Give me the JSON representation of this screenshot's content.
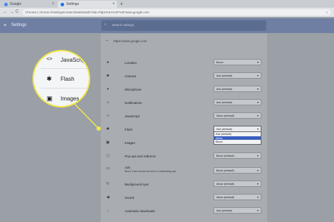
{
  "browser": {
    "tabs": [
      {
        "label": "Google",
        "favicon_color": "#4285f4"
      },
      {
        "label": "Settings",
        "favicon_color": "#1a73e8"
      }
    ],
    "new_tab_glyph": "+",
    "close_glyph": "×",
    "back_glyph": "←",
    "forward_glyph": "→",
    "reload_glyph": "C",
    "address": "Chrome | chrome://settings/content/siteDetails?site=https%3A%2F%2Fwww.google.com",
    "star_glyph": "☆"
  },
  "header": {
    "menu_glyph": "≡",
    "title": "Settings",
    "search_icon": "⌕",
    "search_placeholder": "Search settings"
  },
  "site": {
    "back_glyph": "←",
    "url": "https://www.google.com"
  },
  "permissions": [
    {
      "name": "location",
      "icon": "location-icon",
      "glyph": "●",
      "label": "Location",
      "value": "Block"
    },
    {
      "name": "camera",
      "icon": "camera-icon",
      "glyph": "■",
      "label": "Camera",
      "value": "Ask (default)"
    },
    {
      "name": "microphone",
      "icon": "microphone-icon",
      "glyph": "♦",
      "label": "Microphone",
      "value": "Ask (default)"
    },
    {
      "name": "notifications",
      "icon": "bell-icon",
      "glyph": "♫",
      "label": "Notifications",
      "value": "Ask (default)"
    },
    {
      "name": "javascript",
      "icon": "code-icon",
      "glyph": "‹›",
      "label": "JavaScript",
      "value": "Allow (default)"
    },
    {
      "name": "flash",
      "icon": "puzzle-icon",
      "glyph": "✱",
      "label": "Flash",
      "value": "Ask (default)"
    },
    {
      "name": "images",
      "icon": "image-icon",
      "glyph": "▣",
      "label": "Images",
      "value": ""
    },
    {
      "name": "popups",
      "icon": "popup-icon",
      "glyph": "▢",
      "label": "Pop-ups and redirects",
      "value": "Block (default)"
    },
    {
      "name": "ads",
      "icon": "ads-icon",
      "glyph": "▭",
      "label": "Ads",
      "sub": "Block if site shows intrusive or misleading ads",
      "value": "Block (default)"
    },
    {
      "name": "background-sync",
      "icon": "sync-icon",
      "glyph": "↻",
      "label": "Background sync",
      "value": "Allow (default)"
    },
    {
      "name": "sound",
      "icon": "sound-icon",
      "glyph": "◀",
      "label": "Sound",
      "value": "Allow (default)"
    },
    {
      "name": "automatic-downloads",
      "icon": "download-icon",
      "glyph": "↓",
      "label": "Automatic downloads",
      "value": "Ask (default)"
    }
  ],
  "dropdown_caret": "▾",
  "flash_dropdown": {
    "options": [
      "Ask (default)",
      "Allow",
      "Block"
    ],
    "selected_index": 1
  },
  "magnifier": {
    "rows": [
      {
        "glyph": "<>",
        "label": "JavaScript"
      },
      {
        "glyph": "✱",
        "label": "Flash"
      },
      {
        "glyph": "▣",
        "label": "Images"
      }
    ]
  },
  "colors": {
    "highlight": "#f2e64a",
    "selection": "#3b5fc0"
  }
}
